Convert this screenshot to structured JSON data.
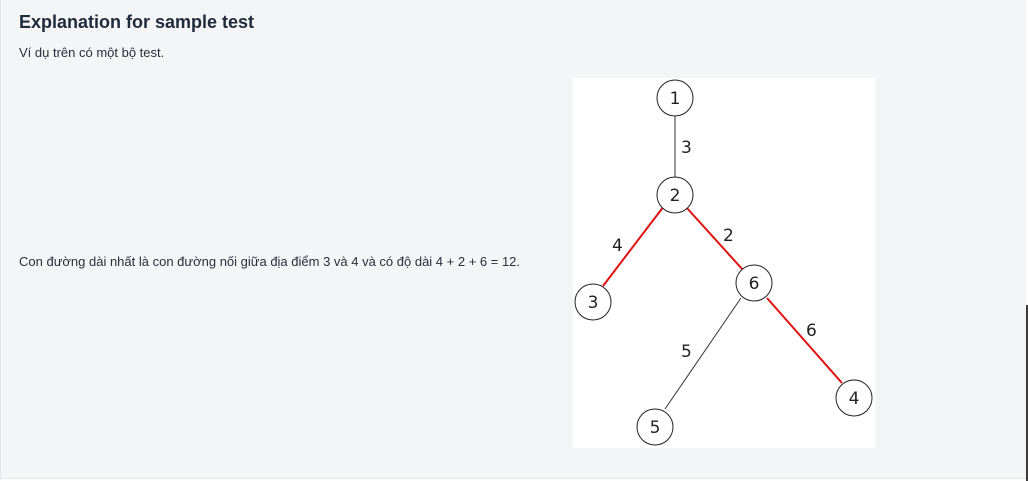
{
  "content": {
    "title": "Explanation for sample test",
    "subtitle": "Ví dụ trên có một bộ test.",
    "explanation": "Con đường dài nhất là con đường nối giữa địa điểm 3 và 4 và có độ dài 4 + 2 + 6 = 12."
  },
  "tree": {
    "nodes": [
      "1",
      "2",
      "3",
      "6",
      "5",
      "4"
    ],
    "edges": [
      {
        "from": "1",
        "to": "2",
        "weight": "3",
        "highlighted": false
      },
      {
        "from": "2",
        "to": "3",
        "weight": "4",
        "highlighted": true
      },
      {
        "from": "2",
        "to": "6",
        "weight": "2",
        "highlighted": true
      },
      {
        "from": "6",
        "to": "5",
        "weight": "5",
        "highlighted": false
      },
      {
        "from": "6",
        "to": "4",
        "weight": "6",
        "highlighted": true
      }
    ],
    "colors": {
      "highlight_edge": "#e01010",
      "normal_edge": "#333333"
    }
  }
}
